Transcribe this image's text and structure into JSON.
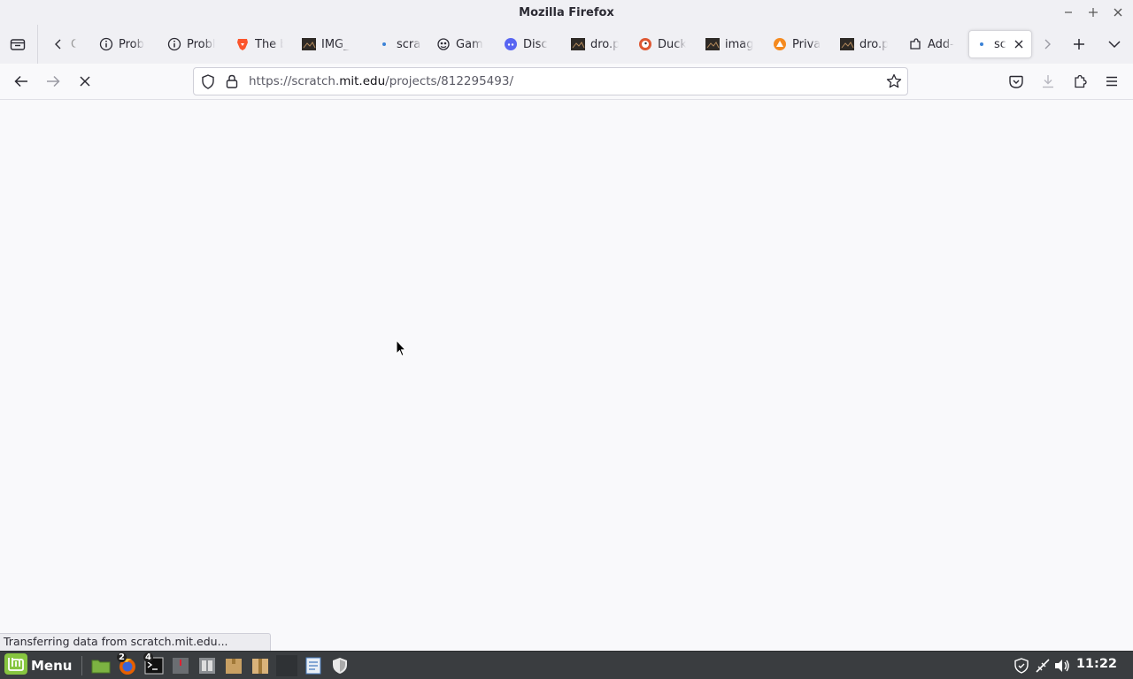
{
  "window": {
    "title": "Mozilla Firefox"
  },
  "tabs": {
    "items": [
      {
        "label": "C",
        "icon": "back-chevron-icon"
      },
      {
        "label": "Prob",
        "icon": "info-icon"
      },
      {
        "label": "Probl",
        "icon": "info-icon"
      },
      {
        "label": "The b",
        "icon": "brave-lion-icon"
      },
      {
        "label": "IMG_",
        "icon": "image-thumb-icon"
      },
      {
        "label": "scrat",
        "icon": "loading-dot-icon"
      },
      {
        "label": "Gam",
        "icon": "gamepad-icon"
      },
      {
        "label": "Disc",
        "icon": "discord-icon"
      },
      {
        "label": "dro.p",
        "icon": "image-thumb-icon"
      },
      {
        "label": "Duck",
        "icon": "duckduckgo-icon"
      },
      {
        "label": "imag",
        "icon": "image-thumb-icon"
      },
      {
        "label": "Priva",
        "icon": "fox-icon"
      },
      {
        "label": "dro.p",
        "icon": "image-thumb-icon"
      },
      {
        "label": "Add-",
        "icon": "puzzle-icon"
      },
      {
        "label": "scr",
        "icon": "loading-dot-icon"
      }
    ]
  },
  "navbar": {
    "url_prefix": "https://scratch.",
    "url_host": "mit.edu",
    "url_path": "/projects/812295493/"
  },
  "status": {
    "text": "Transferring data from scratch.mit.edu..."
  },
  "taskbar": {
    "menu_label": "Menu",
    "firefox_badge": "2",
    "terminal_badge": "4",
    "clock": "11:22"
  },
  "colors": {
    "accent": "#3b82d6",
    "taskbar": "#3a3d40",
    "mint": "#87c540"
  }
}
